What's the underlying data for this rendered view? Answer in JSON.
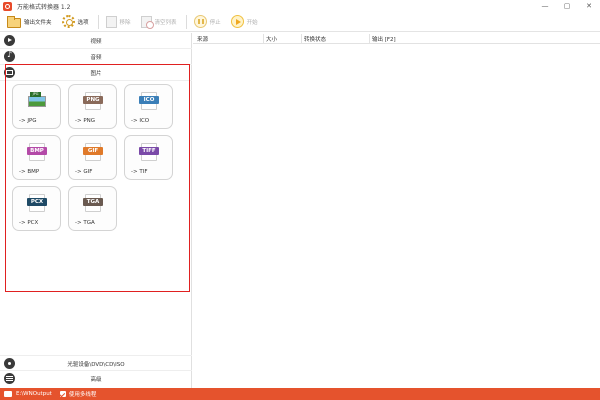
{
  "window": {
    "title": "万能格式转换器 1.2",
    "controls": [
      "—",
      "▢",
      "✕"
    ]
  },
  "toolbar": {
    "output_folder": "输出文件夹",
    "options": "选项",
    "remove": "移除",
    "clear_list": "清空列表",
    "stop": "停止",
    "start": "开始"
  },
  "categories": {
    "video": "视频",
    "audio": "音频",
    "image": "图片",
    "disc": "光驱设备\\DVD\\CD\\ISO",
    "advanced": "高级"
  },
  "image_formats": [
    {
      "badge": "JPG",
      "label": "-> JPG",
      "color": "#2a6f2a",
      "style": "photo"
    },
    {
      "badge": "PNG",
      "label": "-> PNG",
      "color": "#8a6a5a",
      "style": "badge"
    },
    {
      "badge": "ICO",
      "label": "-> ICO",
      "color": "#3b7fb8",
      "style": "badge"
    },
    {
      "badge": "BMP",
      "label": "-> BMP",
      "color": "#b44aa8",
      "style": "badge"
    },
    {
      "badge": "GIF",
      "label": "-> GIF",
      "color": "#e07a2a",
      "style": "badge"
    },
    {
      "badge": "TIFF",
      "label": "-> TIF",
      "color": "#7a4aa8",
      "style": "badge"
    },
    {
      "badge": "PCX",
      "label": "-> PCX",
      "color": "#1f4a66",
      "style": "badge"
    },
    {
      "badge": "TGA",
      "label": "-> TGA",
      "color": "#6a5a50",
      "style": "badge"
    }
  ],
  "file_list": {
    "columns": [
      "来源",
      "大小",
      "转换状态",
      "输出 [F2]"
    ]
  },
  "statusbar": {
    "output_path": "E:\\WNOutput",
    "multithread_label": "使用多线程"
  },
  "colors": {
    "accent": "#e5532d",
    "selection_border": "#e02020"
  }
}
